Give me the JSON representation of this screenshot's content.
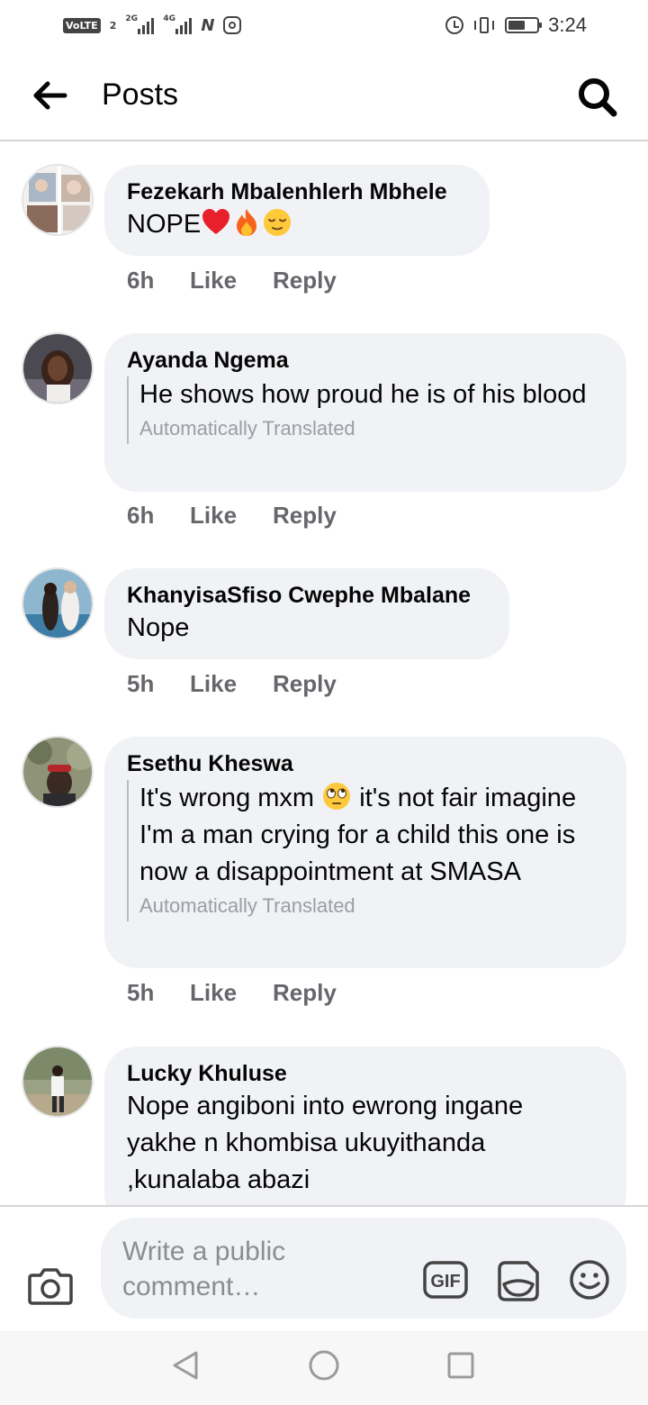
{
  "status_bar": {
    "volte": "VoLTE",
    "sim_number": "2",
    "net1": "2G",
    "net2": "4G",
    "time": "3:24"
  },
  "header": {
    "title": "Posts"
  },
  "comments": [
    {
      "author": "Fezekarh Mbalenhlerh Mbhele",
      "text": "NOPE",
      "emojis": [
        "red-heart",
        "fire",
        "relieved-face"
      ],
      "time": "6h",
      "like": "Like",
      "reply": "Reply"
    },
    {
      "author": "Ayanda Ngema",
      "text": "He shows how proud he is of his blood",
      "translated_note": "Automatically Translated",
      "time": "6h",
      "like": "Like",
      "reply": "Reply"
    },
    {
      "author": "KhanyisaSfiso Cwephe Mbalane",
      "text": "Nope",
      "time": "5h",
      "like": "Like",
      "reply": "Reply"
    },
    {
      "author": "Esethu Kheswa",
      "text_before_emoji": "It's wrong mxm",
      "emoji": "eye-roll",
      "text_after_emoji": "it's not fair imagine I'm a man crying for a child this one is now a disappointment at SMASA",
      "translated_note": "Automatically Translated",
      "time": "5h",
      "like": "Like",
      "reply": "Reply"
    },
    {
      "author": "Lucky Khuluse",
      "text": "Nope angiboni into ewrong ingane yakhe n khombisa ukuyithanda ,kunalaba abazi"
    }
  ],
  "composer": {
    "placeholder": "Write a public comment…",
    "gif_label": "GIF"
  },
  "colors": {
    "bubble": "#f0f2f5",
    "meta_text": "#65676b",
    "translated_text": "#9a9ea5"
  }
}
